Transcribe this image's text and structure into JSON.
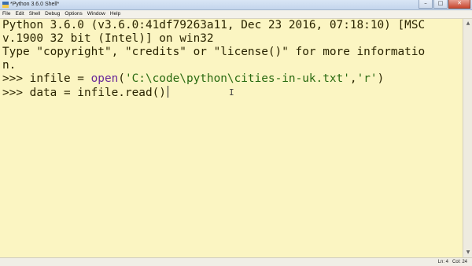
{
  "window": {
    "title": "*Python 3.6.0 Shell*",
    "controls": {
      "minimize": "–",
      "maximize": "□",
      "close": "✕"
    }
  },
  "menu": [
    "File",
    "Edit",
    "Shell",
    "Debug",
    "Options",
    "Window",
    "Help"
  ],
  "shell": {
    "lines": [
      "Python 3.6.0 (v3.6.0:41df79263a11, Dec 23 2016, 07:18:10) [MSC",
      "v.1900 32 bit (Intel)] on win32",
      "Type \"copyright\", \"credits\" or \"license()\" for more informatio",
      "n."
    ],
    "cmd1": {
      "prompt": ">>> ",
      "pre": "infile = ",
      "func": "open",
      "paren_open": "(",
      "arg1": "'C:\\code\\python\\cities-in-uk.txt'",
      "comma": ",",
      "arg2": "'r'",
      "paren_close": ")"
    },
    "cmd2": {
      "prompt": ">>> ",
      "text": "data = infile.read()"
    }
  },
  "status": {
    "line": "Ln: 4",
    "col": "Col: 24"
  },
  "colors": {
    "background": "#fbf5c2",
    "string": "#2a6a10",
    "builtin": "#6a2a9a"
  },
  "icons": {
    "titlebar": "python-idle-icon",
    "cursor": "text-ibeam-cursor"
  }
}
